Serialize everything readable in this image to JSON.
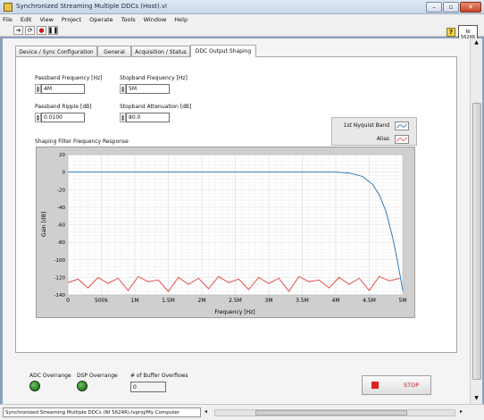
{
  "window": {
    "title": "Synchronized Streaming Multiple DDCs (Host).vi",
    "controls": [
      "–",
      "▫",
      "✕"
    ]
  },
  "menu": [
    "File",
    "Edit",
    "View",
    "Project",
    "Operate",
    "Tools",
    "Window",
    "Help"
  ],
  "toolbar": {
    "help_glyph": "?",
    "vi_icon_text": "NI\n5624R"
  },
  "tabs": [
    "Device / Sync Configuration",
    "General",
    "Acquisition / Status",
    "DDC Output Shaping"
  ],
  "active_tab": "DDC Output Shaping",
  "controls": {
    "passband_frequency": {
      "label": "Passband Frequency [Hz]",
      "value": "4M"
    },
    "stopband_frequency": {
      "label": "Stopband Frequency [Hz]",
      "value": "5M"
    },
    "passband_ripple": {
      "label": "Passband Ripple [dB]",
      "value": "0.0100"
    },
    "stopband_attenuation": {
      "label": "Stopband Attenuation [dB]",
      "value": "80.0"
    }
  },
  "legend": {
    "items": [
      {
        "name": "1st Nyquist Band",
        "color": "#1f6fb0"
      },
      {
        "name": "Alias",
        "color": "#e03a3a"
      }
    ]
  },
  "chart_data": {
    "type": "line",
    "title": "Shaping Filter Frequency Response",
    "xlabel": "Frequency [Hz]",
    "ylabel": "Gain [dB]",
    "xlim": [
      0,
      5000000
    ],
    "ylim": [
      -140,
      20
    ],
    "x_ticks": [
      0,
      500000,
      1000000,
      1500000,
      2000000,
      2500000,
      3000000,
      3500000,
      4000000,
      4500000,
      5000000
    ],
    "x_tick_labels": [
      "0",
      "500k",
      "1M",
      "1.5M",
      "2M",
      "2.5M",
      "3M",
      "3.5M",
      "4M",
      "4.5M",
      "5M"
    ],
    "y_ticks": [
      20,
      0,
      -20,
      -40,
      -60,
      -80,
      -100,
      -120,
      -140
    ],
    "y_tick_labels": [
      "20",
      "0",
      "-20",
      "-40",
      "-60",
      "-80",
      "-100",
      "-120",
      "-140"
    ],
    "grid": true,
    "series": [
      {
        "name": "1st Nyquist Band",
        "color": "#1f6fb0",
        "x": [
          0,
          500000,
          1000000,
          1500000,
          2000000,
          2500000,
          3000000,
          3500000,
          4000000,
          4200000,
          4400000,
          4550000,
          4650000,
          4750000,
          4850000,
          4930000,
          5000000
        ],
        "y": [
          0,
          0,
          0,
          0,
          0,
          0,
          0,
          0,
          0,
          -1,
          -5,
          -14,
          -26,
          -45,
          -75,
          -105,
          -135
        ]
      },
      {
        "name": "Alias",
        "color": "#e03a3a",
        "x": [
          0,
          150000,
          300000,
          450000,
          600000,
          750000,
          900000,
          1050000,
          1200000,
          1350000,
          1500000,
          1650000,
          1800000,
          1950000,
          2100000,
          2250000,
          2400000,
          2550000,
          2700000,
          2850000,
          3000000,
          3150000,
          3300000,
          3450000,
          3600000,
          3750000,
          3900000,
          4050000,
          4200000,
          4350000,
          4500000,
          4650000,
          4800000,
          4950000
        ],
        "y": [
          -126,
          -122,
          -132,
          -120,
          -127,
          -121,
          -135,
          -119,
          -125,
          -123,
          -136,
          -120,
          -128,
          -121,
          -133,
          -119,
          -126,
          -122,
          -134,
          -120,
          -127,
          -121,
          -136,
          -119,
          -125,
          -123,
          -132,
          -120,
          -128,
          -121,
          -135,
          -119,
          -124,
          -121
        ]
      }
    ]
  },
  "status": {
    "adc_overrange_label": "ADC Overrange",
    "dsp_overrange_label": "DSP Overrange",
    "buffer_overflows_label": "# of Buffer Overflows",
    "buffer_overflows_value": "0",
    "stop_label": "STOP"
  },
  "bottom_bar": {
    "project_path": "Synchronized Streaming Multiple DDCs (NI 5624R).lvproj/My Computer"
  },
  "colors": {
    "led_on": "#2e8b2a",
    "stop_square": "#e02020"
  }
}
